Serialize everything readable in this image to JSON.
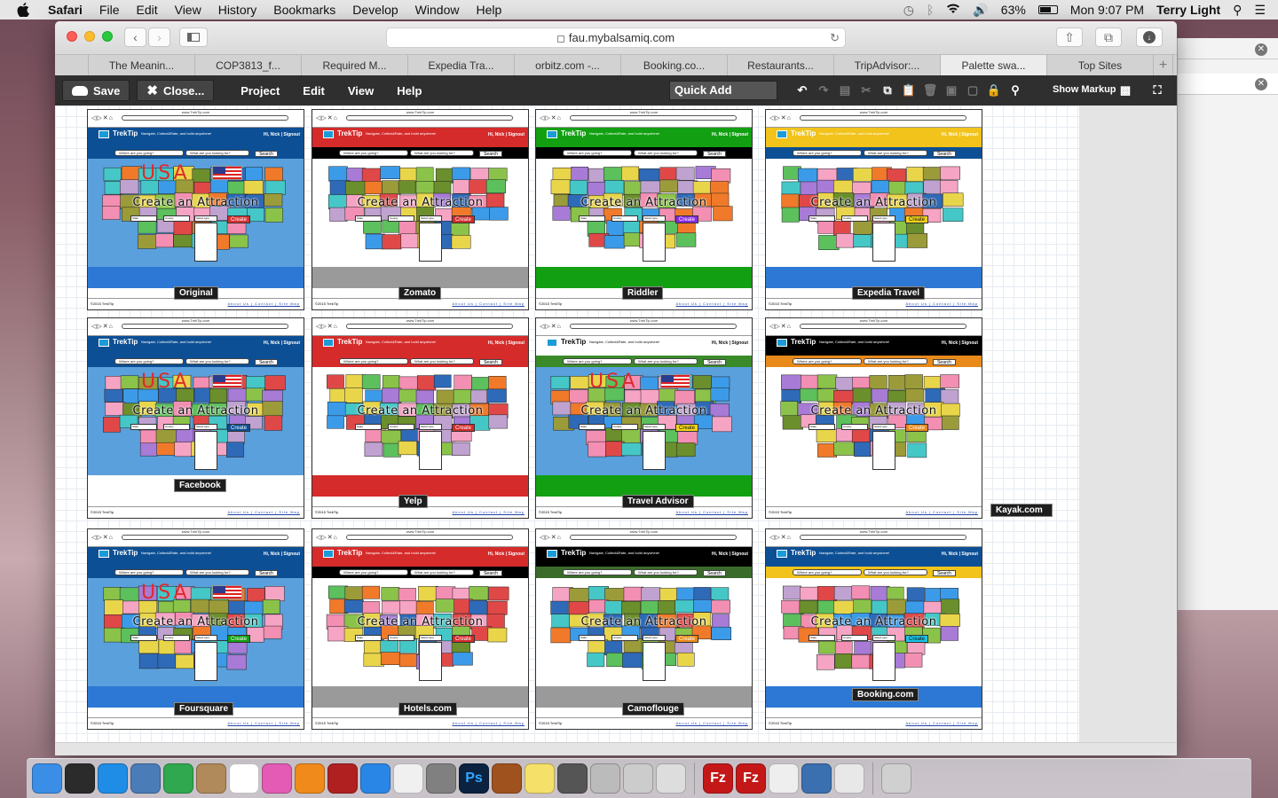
{
  "menubar": {
    "app": "Safari",
    "items": [
      "File",
      "Edit",
      "View",
      "History",
      "Bookmarks",
      "Develop",
      "Window",
      "Help"
    ],
    "battery": "63%",
    "clock": "Mon 9:07 PM",
    "user": "Terry Light"
  },
  "browser": {
    "url": "fau.mybalsamiq.com",
    "tabs": [
      "The Meanin...",
      "COP3813_f...",
      "Required M...",
      "Expedia Tra...",
      "orbitz.com -...",
      "Booking.co...",
      "Restaurants...",
      "TripAdvisor:...",
      "Palette swa...",
      "Top Sites"
    ],
    "active_tab": 8
  },
  "balsamiq": {
    "save": "Save",
    "close": "Close...",
    "menus": [
      "Project",
      "Edit",
      "View",
      "Help"
    ],
    "quick_add": "Quick Add",
    "show_markup": "Show Markup"
  },
  "mockup_text": {
    "url": "www.TrekTip.com",
    "brand": "TrekTip",
    "tagline": "Navigate, Collect&Rate, and build anywhere!",
    "greeting": "Hi, Nick | Signout",
    "where": "Where are you going?",
    "what": "What are you looking for?",
    "search": "Search",
    "create_title": "Create an Attraction",
    "create_btn": "Create",
    "state": "State",
    "county": "County",
    "event": "Select type",
    "usa": "USA",
    "copyright": "©2015 TrekTip",
    "links": "About Us | Contact | Site Map"
  },
  "mockups": [
    {
      "label": "Original",
      "hdr": "#0d4f94",
      "search_bg": "#0d4f94",
      "map_bg": "#5aa0dc",
      "band": "#2d78d4",
      "btn": "#d83232",
      "usa": true
    },
    {
      "label": "Zomato",
      "hdr": "#d52b2b",
      "search_bg": "#000000",
      "map_bg": "#ffffff",
      "band": "#9a9a9a",
      "btn": "#d52b2b",
      "usa": false
    },
    {
      "label": "Riddler",
      "hdr": "#12a012",
      "search_bg": "#000000",
      "map_bg": "#ffffff",
      "band": "#12a012",
      "btn": "#8a2be2",
      "usa": false
    },
    {
      "label": "Expedia Travel",
      "hdr": "#f1c31b",
      "search_bg": "#0d4f94",
      "map_bg": "#ffffff",
      "band": "#2d78d4",
      "btn": "#f1d31b",
      "usa": false
    },
    {
      "label": "Facebook",
      "hdr": "#0d4f94",
      "search_bg": "#0d4f94",
      "map_bg": "#5aa0dc",
      "band": "#ffffff",
      "btn": "#0d4f94",
      "usa": true
    },
    {
      "label": "Yelp",
      "hdr": "#d52b2b",
      "search_bg": "#d52b2b",
      "map_bg": "#ffffff",
      "band": "#d52b2b",
      "btn": "#d52b2b",
      "usa": false
    },
    {
      "label": "Travel Advisor",
      "hdr": "#ffffff",
      "search_bg": "#3b8a2a",
      "map_bg": "#5aa0dc",
      "band": "#12a012",
      "btn": "#f1d31b",
      "usa": true
    },
    {
      "label": "Kayak.com",
      "hdr": "#000000",
      "search_bg": "#e88a1a",
      "map_bg": "#ffffff",
      "band": "#ffffff",
      "btn": "#e88a1a",
      "usa": false
    },
    {
      "label": "Foursquare",
      "hdr": "#0d4f94",
      "search_bg": "#0d4f94",
      "map_bg": "#5aa0dc",
      "band": "#2d78d4",
      "btn": "#12a012",
      "usa": true
    },
    {
      "label": "Hotels.com",
      "hdr": "#d52b2b",
      "search_bg": "#000000",
      "map_bg": "#ffffff",
      "band": "#9a9a9a",
      "btn": "#d52b2b",
      "usa": false
    },
    {
      "label": "Camoflouge",
      "hdr": "#000000",
      "search_bg": "#3b6b2a",
      "map_bg": "#ffffff",
      "band": "#9a9a9a",
      "btn": "#e88a1a",
      "usa": false
    },
    {
      "label": "Booking.com",
      "hdr": "#0d4f94",
      "search_bg": "#f1c31b",
      "map_bg": "#ffffff",
      "band": "#2d78d4",
      "btn": "#1bc3e8",
      "usa": false
    }
  ],
  "dock": [
    {
      "name": "finder-icon",
      "color": "#3a8ee6"
    },
    {
      "name": "dashboard-icon",
      "color": "#2b2b2b"
    },
    {
      "name": "app-store-icon",
      "color": "#1f8de6"
    },
    {
      "name": "preview-icon",
      "color": "#4a7db8"
    },
    {
      "name": "facetime-icon",
      "color": "#2fa84f"
    },
    {
      "name": "contacts-icon",
      "color": "#b08a5a"
    },
    {
      "name": "calendar-icon",
      "color": "#ffffff"
    },
    {
      "name": "itunes-icon",
      "color": "#e35bb4"
    },
    {
      "name": "ibooks-icon",
      "color": "#f08a1a"
    },
    {
      "name": "photo-booth-icon",
      "color": "#b02020"
    },
    {
      "name": "safari-icon",
      "color": "#2a86e6"
    },
    {
      "name": "photos-icon",
      "color": "#f0f0f0"
    },
    {
      "name": "system-preferences-icon",
      "color": "#808080"
    },
    {
      "name": "photoshop-icon",
      "color": "#0b2240"
    },
    {
      "name": "dvd-player-icon",
      "color": "#a0521e"
    },
    {
      "name": "stickies-icon",
      "color": "#f5e16a"
    },
    {
      "name": "screenshot-icon",
      "color": "#555555"
    },
    {
      "name": "image-capture-icon",
      "color": "#bbbbbb"
    },
    {
      "name": "printer-icon",
      "color": "#cccccc"
    },
    {
      "name": "help-icon",
      "color": "#dddddd"
    },
    {
      "name": "filezilla-icon",
      "color": "#c41818"
    },
    {
      "name": "filezilla-2-icon",
      "color": "#c41818"
    },
    {
      "name": "textedit-icon",
      "color": "#eeeeee"
    },
    {
      "name": "instruments-icon",
      "color": "#3a6fb0"
    },
    {
      "name": "acrobat-icon",
      "color": "#e8e8e8"
    },
    {
      "name": "trash-icon",
      "color": "#d0d0d0"
    }
  ]
}
